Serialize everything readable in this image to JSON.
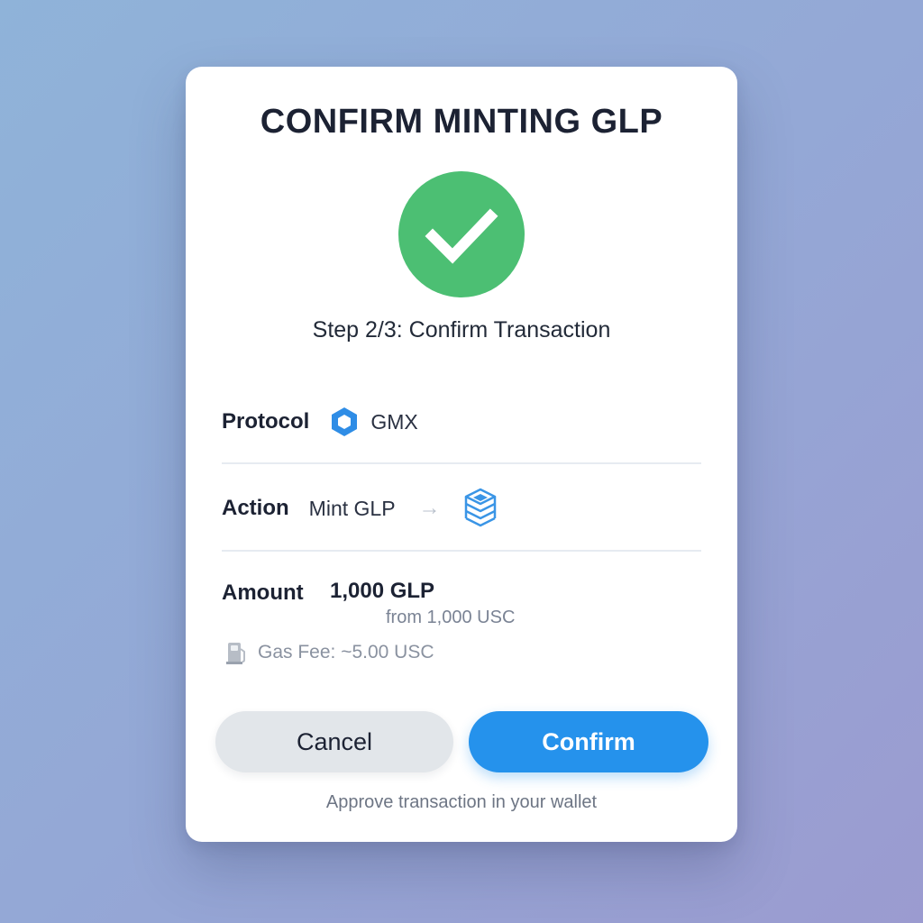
{
  "modal": {
    "title": "CONFIRM MINTING GLP",
    "status_icon": "checkmark-icon",
    "step_text": "Step 2/3: Confirm Transaction",
    "colors": {
      "success": "#4cbf73",
      "accent": "#2592ec"
    }
  },
  "details": {
    "protocol_label": "Protocol",
    "protocol_icon": "hexagon-icon",
    "protocol_value": "GMX",
    "action_label": "Action",
    "action_value": "Mint GLP",
    "action_arrow_icon": "arrow-right-icon",
    "action_target_icon": "layers-icon",
    "amount_label": "Amount",
    "amount_value": "1,000 GLP",
    "amount_from": "from 1,000 USC",
    "gas_icon": "gas-pump-icon",
    "gas_fee": "Gas Fee: ~5.00 USC"
  },
  "actions": {
    "cancel_label": "Cancel",
    "confirm_label": "Confirm"
  },
  "footer": {
    "hint": "Approve transaction in your wallet"
  }
}
